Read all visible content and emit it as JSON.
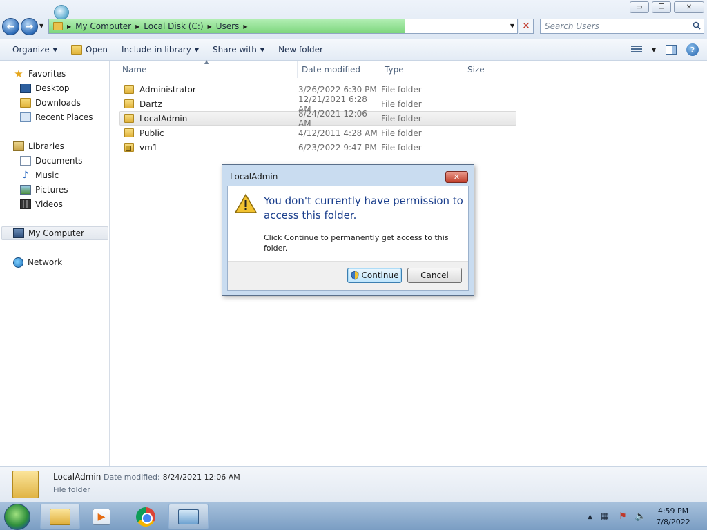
{
  "window": {
    "address": {
      "crumbs": [
        "My Computer",
        "Local Disk (C:)",
        "Users"
      ],
      "load_progress": 0.76
    },
    "search": {
      "placeholder": "Search Users"
    },
    "controls": {
      "minimize": "▭",
      "maximize": "❐",
      "close": "✕"
    }
  },
  "toolbar": {
    "organize": "Organize",
    "open": "Open",
    "include_in_library": "Include in library",
    "share_with": "Share with",
    "new_folder": "New folder",
    "help": "?"
  },
  "navpane": {
    "favorites": "Favorites",
    "desktop": "Desktop",
    "downloads": "Downloads",
    "recent_places": "Recent Places",
    "libraries": "Libraries",
    "documents": "Documents",
    "music": "Music",
    "pictures": "Pictures",
    "videos": "Videos",
    "my_computer": "My Computer",
    "network": "Network"
  },
  "filelist": {
    "columns": {
      "name": "Name",
      "date_modified": "Date modified",
      "type": "Type",
      "size": "Size"
    },
    "rows": [
      {
        "name": "Administrator",
        "date": "3/26/2022 6:30 PM",
        "type": "File folder"
      },
      {
        "name": "Dartz",
        "date": "12/21/2021 6:28 AM",
        "type": "File folder"
      },
      {
        "name": "LocalAdmin",
        "date": "8/24/2021 12:06 AM",
        "type": "File folder"
      },
      {
        "name": "Public",
        "date": "4/12/2011 4:28 AM",
        "type": "File folder"
      },
      {
        "name": "vm1",
        "date": "6/23/2022 9:47 PM",
        "type": "File folder"
      }
    ]
  },
  "details": {
    "name": "LocalAdmin",
    "date_label": "Date modified:",
    "date_value": "8/24/2021 12:06 AM",
    "type": "File folder"
  },
  "dialog": {
    "title": "LocalAdmin",
    "main_instruction": "You don't currently have permission to access this folder.",
    "content": "Click Continue to permanently get access to this folder.",
    "continue_label": "Continue",
    "cancel_label": "Cancel",
    "close": "✕"
  },
  "taskbar": {
    "clock_time": "4:59 PM",
    "clock_date": "7/8/2022"
  }
}
